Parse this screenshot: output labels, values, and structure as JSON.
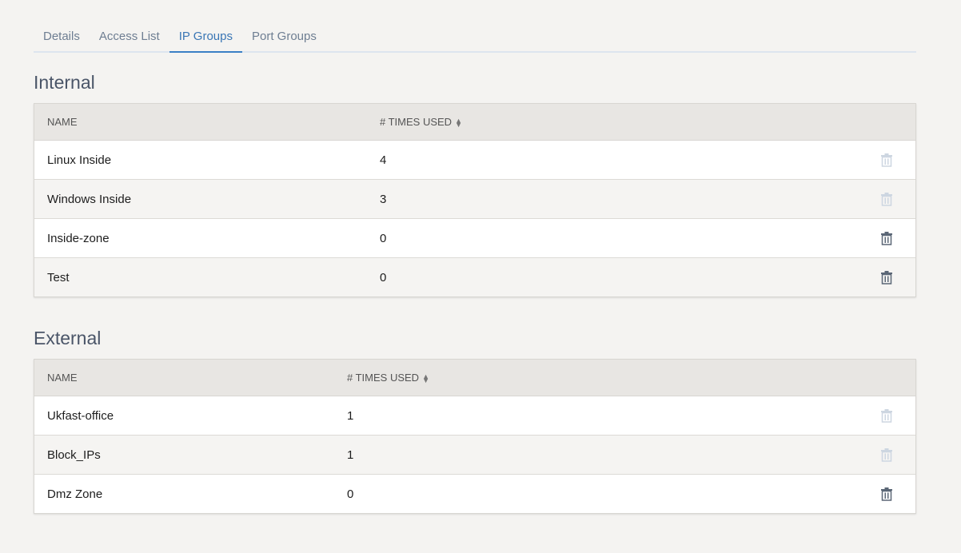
{
  "tabs": [
    {
      "label": "Details",
      "active": false
    },
    {
      "label": "Access List",
      "active": false
    },
    {
      "label": "IP Groups",
      "active": true
    },
    {
      "label": "Port Groups",
      "active": false
    }
  ],
  "colors": {
    "accent": "#3a7fc6",
    "trash_enabled": "#5b6776",
    "trash_disabled": "#cdd6e1"
  },
  "internal": {
    "title": "Internal",
    "headers": {
      "name": "NAME",
      "used": "# TIMES USED"
    },
    "rows": [
      {
        "name": "Linux Inside",
        "used": "4",
        "deletable": false
      },
      {
        "name": "Windows Inside",
        "used": "3",
        "deletable": false
      },
      {
        "name": "Inside-zone",
        "used": "0",
        "deletable": true
      },
      {
        "name": "Test",
        "used": "0",
        "deletable": true
      }
    ]
  },
  "external": {
    "title": "External",
    "headers": {
      "name": "NAME",
      "used": "# TIMES USED"
    },
    "rows": [
      {
        "name": "Ukfast-office",
        "used": "1",
        "deletable": false
      },
      {
        "name": "Block_IPs",
        "used": "1",
        "deletable": false
      },
      {
        "name": "Dmz Zone",
        "used": "0",
        "deletable": true
      }
    ]
  }
}
